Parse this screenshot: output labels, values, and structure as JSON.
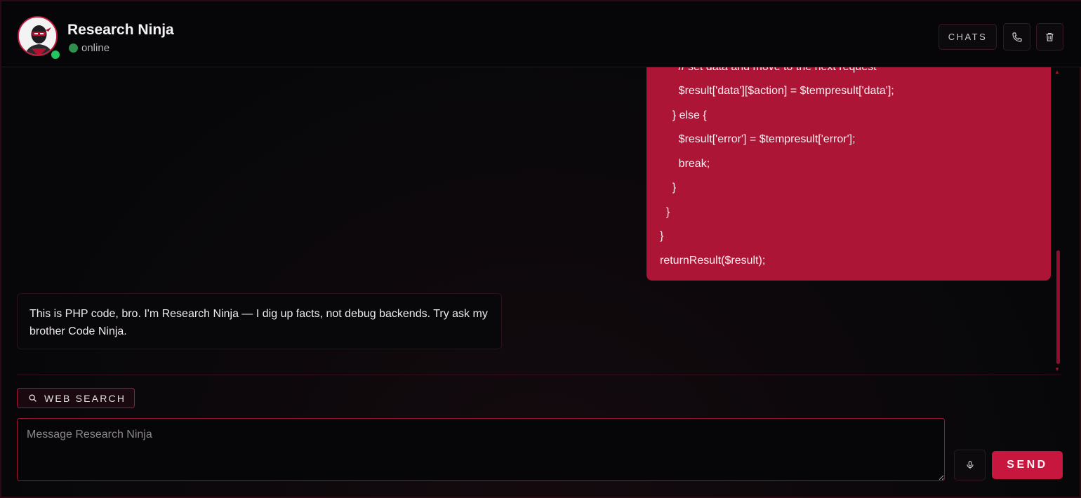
{
  "header": {
    "title": "Research Ninja",
    "status": "online",
    "chats_label": "CHATS",
    "icons": {
      "call": "phone-icon",
      "delete": "trash-icon"
    }
  },
  "messages": {
    "user_code_lines": [
      "      // set data and move to the next request",
      "      $result['data'][$action] = $tempresult['data'];",
      "    } else {",
      "      $result['error'] = $tempresult['error'];",
      "      break;",
      "    }",
      "  }",
      "}",
      "returnResult($result);"
    ],
    "bot_reply": "This is PHP code, bro. I'm Research Ninja — I dig up facts, not debug backends. Try ask my brother Code Ninja."
  },
  "composer": {
    "web_search_label": "WEB SEARCH",
    "placeholder": "Message Research Ninja",
    "send_label": "SEND",
    "icons": {
      "search": "search-icon",
      "mic": "microphone-icon"
    }
  },
  "colors": {
    "accent": "#c8173f",
    "user_bubble": "#ad1536",
    "online": "#22c55e"
  }
}
